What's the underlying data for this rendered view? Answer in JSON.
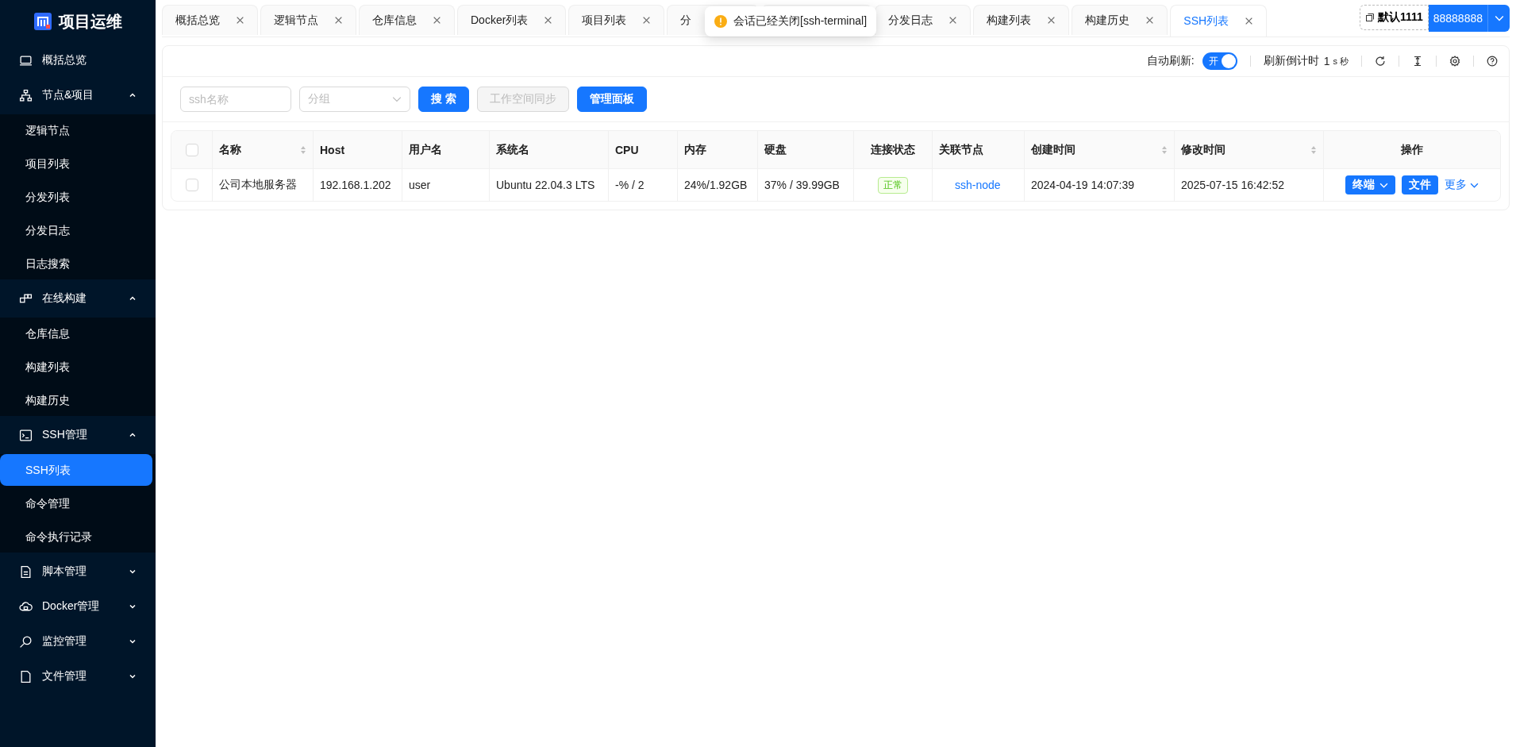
{
  "logo": {
    "title": "项目运维"
  },
  "menu": [
    {
      "label": "概括总览"
    },
    {
      "label": "节点&项目",
      "expanded": true,
      "children": [
        {
          "label": "逻辑节点",
          "selected": false
        },
        {
          "label": "项目列表",
          "selected": false
        },
        {
          "label": "分发列表",
          "selected": false
        },
        {
          "label": "分发日志",
          "selected": false
        },
        {
          "label": "日志搜索",
          "selected": false
        }
      ]
    },
    {
      "label": "在线构建",
      "expanded": true,
      "children": [
        {
          "label": "仓库信息",
          "selected": false
        },
        {
          "label": "构建列表",
          "selected": false
        },
        {
          "label": "构建历史",
          "selected": false
        }
      ]
    },
    {
      "label": "SSH管理",
      "expanded": true,
      "children": [
        {
          "label": "SSH列表",
          "selected": true
        },
        {
          "label": "命令管理",
          "selected": false
        },
        {
          "label": "命令执行记录",
          "selected": false
        }
      ]
    },
    {
      "label": "脚本管理",
      "expanded": false
    },
    {
      "label": "Docker管理",
      "expanded": false
    },
    {
      "label": "监控管理",
      "expanded": false
    },
    {
      "label": "文件管理",
      "expanded": false
    }
  ],
  "tabs": [
    {
      "label": "概括总览",
      "selected": false
    },
    {
      "label": "逻辑节点",
      "selected": false
    },
    {
      "label": "仓库信息",
      "selected": false
    },
    {
      "label": "Docker列表",
      "selected": false
    },
    {
      "label": "项目列表",
      "selected": false
    },
    {
      "label": "分",
      "selected": false
    },
    {
      "selected": false
    },
    {
      "label": "分发日志",
      "selected": false
    },
    {
      "label": "构建列表",
      "selected": false
    },
    {
      "label": "构建历史",
      "selected": false
    },
    {
      "label": "SSH列表",
      "selected": true
    }
  ],
  "toast": {
    "message": "会话已经关闭[ssh-terminal]"
  },
  "workspace": {
    "label": "默认1111"
  },
  "user": {
    "label": "88888888"
  },
  "toolbar": {
    "auto_refresh": {
      "label": "自动刷新:",
      "on": true,
      "text": "开"
    },
    "countdown": {
      "label": "刷新倒计时",
      "value": "1",
      "unit": "s 秒"
    }
  },
  "filters": {
    "name": {
      "placeholder": "ssh名称"
    },
    "group": {
      "placeholder": "分组"
    },
    "buttons": [
      {
        "label": "搜 索",
        "disabled": false
      },
      {
        "label": "工作空间同步",
        "disabled": true
      },
      {
        "label": "管理面板",
        "disabled": false
      }
    ]
  },
  "table": {
    "all_checked": false,
    "columns": [
      {
        "label": "名称",
        "sortable": true
      },
      {
        "label": "Host",
        "sortable": false
      },
      {
        "label": "用户名",
        "sortable": false
      },
      {
        "label": "系统名",
        "sortable": false
      },
      {
        "label": "CPU",
        "sortable": false
      },
      {
        "label": "内存",
        "sortable": false
      },
      {
        "label": "硬盘",
        "sortable": false
      },
      {
        "label": "连接状态",
        "sortable": false
      },
      {
        "label": "关联节点",
        "sortable": false
      },
      {
        "label": "创建时间",
        "sortable": true
      },
      {
        "label": "修改时间",
        "sortable": true
      },
      {
        "label": "操作",
        "sortable": false
      }
    ],
    "rows": [
      {
        "checked": false,
        "cells": [
          {
            "kind": "text",
            "text": "公司本地服务器"
          },
          {
            "kind": "text",
            "text": "192.168.1.202"
          },
          {
            "kind": "text",
            "text": "user"
          },
          {
            "kind": "text",
            "text": "Ubuntu 22.04.3 LTS"
          },
          {
            "kind": "text",
            "text": "-% / 2"
          },
          {
            "kind": "text",
            "text": "24%/1.92GB"
          },
          {
            "kind": "text",
            "text": "37% / 39.99GB"
          },
          {
            "kind": "tag",
            "text": "正常"
          },
          {
            "kind": "link",
            "text": "ssh-node"
          },
          {
            "kind": "text",
            "text": "2024-04-19 14:07:39"
          },
          {
            "kind": "text",
            "text": "2025-07-15 16:42:52"
          },
          {
            "kind": "actions",
            "items": [
              {
                "kind": "dropdown-button",
                "label": "终端"
              },
              {
                "kind": "button",
                "label": "文件"
              },
              {
                "kind": "dropdown-link",
                "label": "更多"
              }
            ]
          }
        ]
      }
    ]
  }
}
